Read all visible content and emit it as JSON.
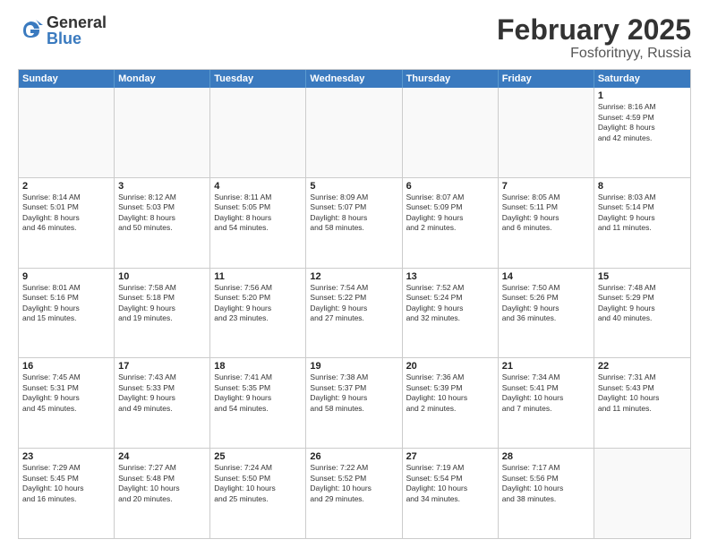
{
  "logo": {
    "general": "General",
    "blue": "Blue"
  },
  "title": "February 2025",
  "subtitle": "Fosforitnyy, Russia",
  "header_days": [
    "Sunday",
    "Monday",
    "Tuesday",
    "Wednesday",
    "Thursday",
    "Friday",
    "Saturday"
  ],
  "weeks": [
    [
      {
        "day": "",
        "text": ""
      },
      {
        "day": "",
        "text": ""
      },
      {
        "day": "",
        "text": ""
      },
      {
        "day": "",
        "text": ""
      },
      {
        "day": "",
        "text": ""
      },
      {
        "day": "",
        "text": ""
      },
      {
        "day": "1",
        "text": "Sunrise: 8:16 AM\nSunset: 4:59 PM\nDaylight: 8 hours\nand 42 minutes."
      }
    ],
    [
      {
        "day": "2",
        "text": "Sunrise: 8:14 AM\nSunset: 5:01 PM\nDaylight: 8 hours\nand 46 minutes."
      },
      {
        "day": "3",
        "text": "Sunrise: 8:12 AM\nSunset: 5:03 PM\nDaylight: 8 hours\nand 50 minutes."
      },
      {
        "day": "4",
        "text": "Sunrise: 8:11 AM\nSunset: 5:05 PM\nDaylight: 8 hours\nand 54 minutes."
      },
      {
        "day": "5",
        "text": "Sunrise: 8:09 AM\nSunset: 5:07 PM\nDaylight: 8 hours\nand 58 minutes."
      },
      {
        "day": "6",
        "text": "Sunrise: 8:07 AM\nSunset: 5:09 PM\nDaylight: 9 hours\nand 2 minutes."
      },
      {
        "day": "7",
        "text": "Sunrise: 8:05 AM\nSunset: 5:11 PM\nDaylight: 9 hours\nand 6 minutes."
      },
      {
        "day": "8",
        "text": "Sunrise: 8:03 AM\nSunset: 5:14 PM\nDaylight: 9 hours\nand 11 minutes."
      }
    ],
    [
      {
        "day": "9",
        "text": "Sunrise: 8:01 AM\nSunset: 5:16 PM\nDaylight: 9 hours\nand 15 minutes."
      },
      {
        "day": "10",
        "text": "Sunrise: 7:58 AM\nSunset: 5:18 PM\nDaylight: 9 hours\nand 19 minutes."
      },
      {
        "day": "11",
        "text": "Sunrise: 7:56 AM\nSunset: 5:20 PM\nDaylight: 9 hours\nand 23 minutes."
      },
      {
        "day": "12",
        "text": "Sunrise: 7:54 AM\nSunset: 5:22 PM\nDaylight: 9 hours\nand 27 minutes."
      },
      {
        "day": "13",
        "text": "Sunrise: 7:52 AM\nSunset: 5:24 PM\nDaylight: 9 hours\nand 32 minutes."
      },
      {
        "day": "14",
        "text": "Sunrise: 7:50 AM\nSunset: 5:26 PM\nDaylight: 9 hours\nand 36 minutes."
      },
      {
        "day": "15",
        "text": "Sunrise: 7:48 AM\nSunset: 5:29 PM\nDaylight: 9 hours\nand 40 minutes."
      }
    ],
    [
      {
        "day": "16",
        "text": "Sunrise: 7:45 AM\nSunset: 5:31 PM\nDaylight: 9 hours\nand 45 minutes."
      },
      {
        "day": "17",
        "text": "Sunrise: 7:43 AM\nSunset: 5:33 PM\nDaylight: 9 hours\nand 49 minutes."
      },
      {
        "day": "18",
        "text": "Sunrise: 7:41 AM\nSunset: 5:35 PM\nDaylight: 9 hours\nand 54 minutes."
      },
      {
        "day": "19",
        "text": "Sunrise: 7:38 AM\nSunset: 5:37 PM\nDaylight: 9 hours\nand 58 minutes."
      },
      {
        "day": "20",
        "text": "Sunrise: 7:36 AM\nSunset: 5:39 PM\nDaylight: 10 hours\nand 2 minutes."
      },
      {
        "day": "21",
        "text": "Sunrise: 7:34 AM\nSunset: 5:41 PM\nDaylight: 10 hours\nand 7 minutes."
      },
      {
        "day": "22",
        "text": "Sunrise: 7:31 AM\nSunset: 5:43 PM\nDaylight: 10 hours\nand 11 minutes."
      }
    ],
    [
      {
        "day": "23",
        "text": "Sunrise: 7:29 AM\nSunset: 5:45 PM\nDaylight: 10 hours\nand 16 minutes."
      },
      {
        "day": "24",
        "text": "Sunrise: 7:27 AM\nSunset: 5:48 PM\nDaylight: 10 hours\nand 20 minutes."
      },
      {
        "day": "25",
        "text": "Sunrise: 7:24 AM\nSunset: 5:50 PM\nDaylight: 10 hours\nand 25 minutes."
      },
      {
        "day": "26",
        "text": "Sunrise: 7:22 AM\nSunset: 5:52 PM\nDaylight: 10 hours\nand 29 minutes."
      },
      {
        "day": "27",
        "text": "Sunrise: 7:19 AM\nSunset: 5:54 PM\nDaylight: 10 hours\nand 34 minutes."
      },
      {
        "day": "28",
        "text": "Sunrise: 7:17 AM\nSunset: 5:56 PM\nDaylight: 10 hours\nand 38 minutes."
      },
      {
        "day": "",
        "text": ""
      }
    ]
  ]
}
